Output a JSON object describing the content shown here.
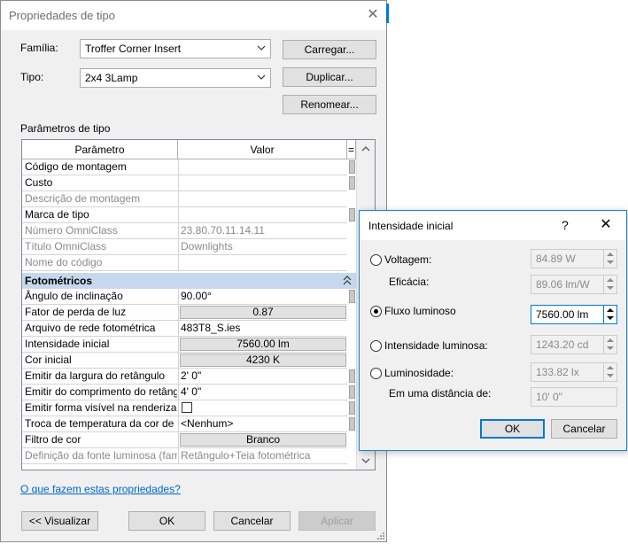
{
  "main_dialog": {
    "title": "Propriedades de tipo",
    "close_glyph": "✕",
    "family_label": "Família:",
    "family_value": "Troffer Corner Insert",
    "type_label": "Tipo:",
    "type_value": "2x4 3Lamp",
    "load_button": "Carregar...",
    "duplicate_button": "Duplicar...",
    "rename_button": "Renomear...",
    "type_params_label": "Parâmetros de tipo",
    "grid": {
      "col_param": "Parâmetro",
      "col_value": "Valor",
      "col_toggle": "=",
      "rows_top": [
        {
          "name": "Código de montagem",
          "value": "",
          "greyed": false
        },
        {
          "name": "Custo",
          "value": "",
          "greyed": false
        },
        {
          "name": "Descrição de montagem",
          "value": "",
          "greyed": true
        },
        {
          "name": "Marca de tipo",
          "value": "",
          "greyed": false
        },
        {
          "name": "Número OmniClass",
          "value": "23.80.70.11.14.11",
          "greyed": true
        },
        {
          "name": "Título OmniClass",
          "value": "Downlights",
          "greyed": true
        },
        {
          "name": "Nome do código",
          "value": "",
          "greyed": true
        }
      ],
      "section_title": "Fotométricos",
      "rows_photo": [
        {
          "name": "Ângulo de inclinação",
          "value": "90.00°"
        },
        {
          "name": "Fator de perda de luz",
          "value": "0.87"
        },
        {
          "name": "Arquivo de rede fotométrica",
          "value": "483T8_S.ies"
        },
        {
          "name": "Intensidade inicial",
          "value": "7560.00 lm"
        },
        {
          "name": "Cor inicial",
          "value": "4230 K"
        },
        {
          "name": "Emitir da largura do retângulo",
          "value": "2'  0\""
        },
        {
          "name": "Emitir do comprimento do retângulo",
          "value": "4'  0\""
        },
        {
          "name": "Emitir forma visível na renderização",
          "value": ""
        },
        {
          "name": "Troca de temperatura da cor de luz",
          "value": "<Nenhum>"
        },
        {
          "name": "Filtro de cor",
          "value": "Branco"
        },
        {
          "name": "Definição da fonte luminosa (família)",
          "value": "Retângulo+Teia fotométrica"
        }
      ]
    },
    "help_link": "O que fazem estas propriedades?",
    "preview_button": "<< Visualizar",
    "ok_button": "OK",
    "cancel_button": "Cancelar",
    "apply_button": "Aplicar"
  },
  "sub_dialog": {
    "title": "Intensidade inicial",
    "help_glyph": "?",
    "close_glyph": "✕",
    "voltage_label": "Voltagem:",
    "voltage_value": "84.89 W",
    "efficacy_label": "Eficácia:",
    "efficacy_value": "89.06 lm/W",
    "flux_label": "Fluxo luminoso",
    "flux_value": "7560.00 lm",
    "intensity_label": "Intensidade luminosa:",
    "intensity_value": "1243.20 cd",
    "luminance_label": "Luminosidade:",
    "luminance_value": "133.82 lx",
    "distance_label": "Em uma distância de:",
    "distance_value": "10'  0\"",
    "ok_button": "OK",
    "cancel_button": "Cancelar",
    "selected_option": "Fluxo luminoso"
  },
  "colors": {
    "accent": "#0078d7",
    "section_bg": "#c6d8ef",
    "link": "#0066cc"
  }
}
